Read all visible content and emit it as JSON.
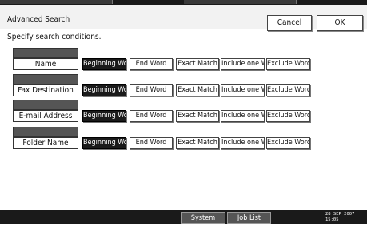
{
  "window": {
    "title": "Advanced Search",
    "cancel_label": "Cancel",
    "ok_label": "OK"
  },
  "prompt": "Specify search conditions.",
  "fields": [
    {
      "label": "Name",
      "selected_option": null
    },
    {
      "label": "Fax Destination",
      "selected_option": "Beginning Word"
    },
    {
      "label": "E-mail Address",
      "selected_option": "Beginning Word"
    },
    {
      "label": "Folder Name",
      "selected_option": "Beginning Word"
    }
  ],
  "options": [
    "Beginning Word",
    "End Word",
    "Exact Match",
    "Include one Word",
    "Exclude Words"
  ],
  "statusbar": {
    "system_status_label": "System Status",
    "job_list_label": "Job List",
    "date": "28 SEP 2007",
    "time": "15:05"
  },
  "colors": {
    "selected_bg": "#1a1a1a",
    "field_tab": "#555555",
    "statusbar_bg": "#1a1a1a"
  }
}
